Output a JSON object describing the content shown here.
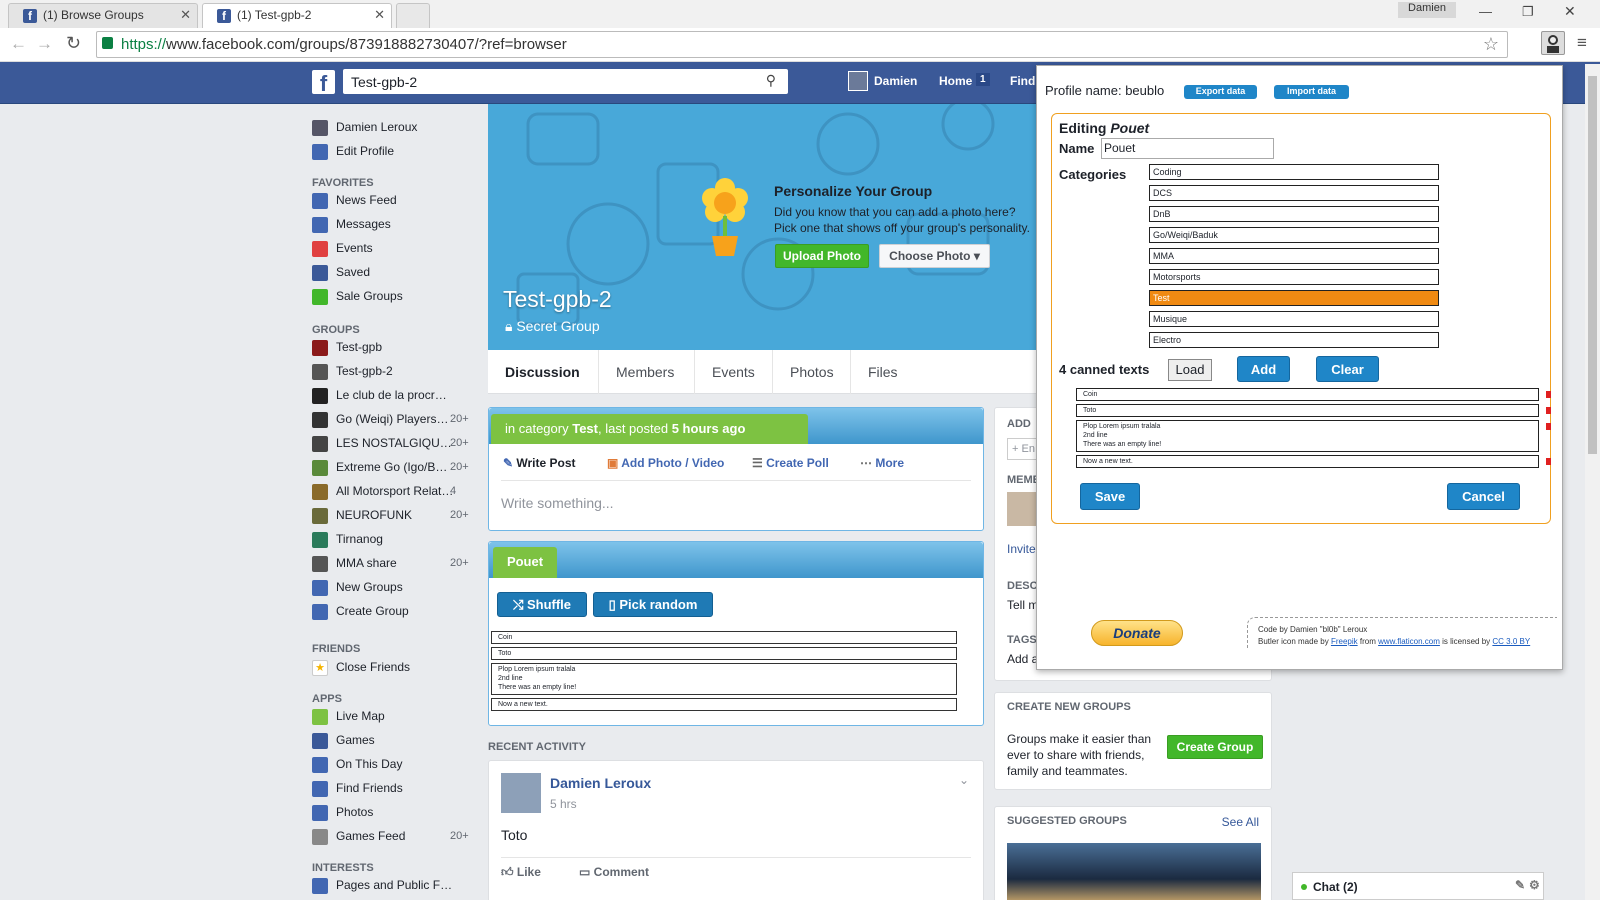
{
  "browser": {
    "tabs": [
      {
        "label": "(1) Browse Groups"
      },
      {
        "label": "(1) Test-gpb-2"
      }
    ],
    "user": "Damien",
    "url_scheme": "https://",
    "url_rest": "www.facebook.com/groups/873918882730407/?ref=browser"
  },
  "fb_header": {
    "search_value": "Test-gpb-2",
    "profile_name": "Damien",
    "home_label": "Home",
    "home_count": "1",
    "find_label": "Find"
  },
  "left_nav": {
    "profile": "Damien Leroux",
    "edit_profile": "Edit Profile",
    "favorites_header": "FAVORITES",
    "favorites": [
      {
        "label": "News Feed",
        "color": "#4267b2"
      },
      {
        "label": "Messages",
        "color": "#4267b2"
      },
      {
        "label": "Events",
        "color": "#e04040"
      },
      {
        "label": "Saved",
        "color": "#3b5998"
      },
      {
        "label": "Sale Groups",
        "color": "#42b72a"
      }
    ],
    "groups_header": "GROUPS",
    "groups": [
      {
        "label": "Test-gpb",
        "count": ""
      },
      {
        "label": "Test-gpb-2",
        "count": ""
      },
      {
        "label": "Le club de la procr…",
        "count": ""
      },
      {
        "label": "Go (Weiqi) Players…",
        "count": "20+"
      },
      {
        "label": "LES NOSTALGIQU…",
        "count": "20+"
      },
      {
        "label": "Extreme Go (Igo/B…",
        "count": "20+"
      },
      {
        "label": "All Motorsport Relat…",
        "count": "4"
      },
      {
        "label": "NEUROFUNK",
        "count": "20+"
      },
      {
        "label": "Tirnanog",
        "count": ""
      },
      {
        "label": "MMA share",
        "count": "20+"
      },
      {
        "label": "New Groups",
        "count": ""
      },
      {
        "label": "Create Group",
        "count": ""
      }
    ],
    "friends_header": "FRIENDS",
    "close_friends": "Close Friends",
    "apps_header": "APPS",
    "apps": [
      {
        "label": "Live Map",
        "count": ""
      },
      {
        "label": "Games",
        "count": ""
      },
      {
        "label": "On This Day",
        "count": ""
      },
      {
        "label": "Find Friends",
        "count": ""
      },
      {
        "label": "Photos",
        "count": ""
      },
      {
        "label": "Games Feed",
        "count": "20+"
      }
    ],
    "interests_header": "INTERESTS",
    "pages": "Pages and Public F…"
  },
  "cover": {
    "promo_title": "Personalize Your Group",
    "promo_line1": "Did you know that you can add a photo here?",
    "promo_line2": "Pick one that shows off your group's personality.",
    "upload": "Upload Photo",
    "choose": "Choose Photo ▾",
    "group_name": "Test-gpb-2",
    "privacy": "Secret Group"
  },
  "group_tabs": [
    "Discussion",
    "Members",
    "Events",
    "Photos",
    "Files"
  ],
  "composer": {
    "banner_prefix": "in category",
    "banner_category": "Test",
    "banner_middle": ", last posted",
    "banner_time": "5 hours ago",
    "write_post": "Write Post",
    "add_photo": "Add Photo / Video",
    "create_poll": "Create Poll",
    "more": "More",
    "placeholder": "Write something..."
  },
  "canned_panel": {
    "tab_label": "Pouet",
    "shuffle": "Shuffle",
    "pick_random": "Pick random",
    "texts": [
      "Coin",
      "Toto",
      "Plop Lorem ipsum tralala",
      "2nd line",
      "There was an empty line!",
      "Now a new text."
    ]
  },
  "recent": {
    "header": "RECENT ACTIVITY",
    "author": "Damien Leroux",
    "time": "5 hrs",
    "body": "Toto",
    "like": "Like",
    "comment": "Comment"
  },
  "right_col": {
    "add": "ADD",
    "add_input": "+ En",
    "members": "MEMB",
    "invite": "Invite",
    "desc": "DESC",
    "desc_text": "Tell m",
    "tags": "TAGS",
    "tags_text": "Add a",
    "create_header": "CREATE NEW GROUPS",
    "create_text": "Groups make it easier than ever to share with friends, family and teammates.",
    "create_btn": "Create Group",
    "suggested_header": "SUGGESTED GROUPS",
    "see_all": "See All"
  },
  "chat": {
    "label": "Chat (2)"
  },
  "popup": {
    "profile_label": "Profile name: beublo",
    "export": "Export data",
    "import": "Import data",
    "editing_prefix": "Editing",
    "editing_name": "Pouet",
    "name_label": "Name",
    "name_value": "Pouet",
    "categories_label": "Categories",
    "categories": [
      {
        "label": "Coding",
        "selected": false
      },
      {
        "label": "DCS",
        "selected": false
      },
      {
        "label": "DnB",
        "selected": false
      },
      {
        "label": "Go/Weiqi/Baduk",
        "selected": false
      },
      {
        "label": "MMA",
        "selected": false
      },
      {
        "label": "Motorsports",
        "selected": false
      },
      {
        "label": "Test",
        "selected": true
      },
      {
        "label": "Musique",
        "selected": false
      },
      {
        "label": "Electro",
        "selected": false
      }
    ],
    "canned_count": "4 canned texts",
    "load": "Load",
    "add": "Add",
    "clear": "Clear",
    "texts": [
      "Coin",
      "Toto",
      "Plop Lorem ipsum tralala",
      "2nd line",
      "There was an empty line!",
      "Now a new text."
    ],
    "save": "Save",
    "cancel": "Cancel",
    "donate": "Donate",
    "credit1": "Code by Damien \"bl0b\" Leroux",
    "credit2_prefix": "Butler icon made by",
    "credit2_a": "Freepik",
    "credit2_from": "from",
    "credit2_b": "www.flaticon.com",
    "credit2_lic": "is licensed by",
    "credit2_c": "CC 3.0 BY"
  }
}
